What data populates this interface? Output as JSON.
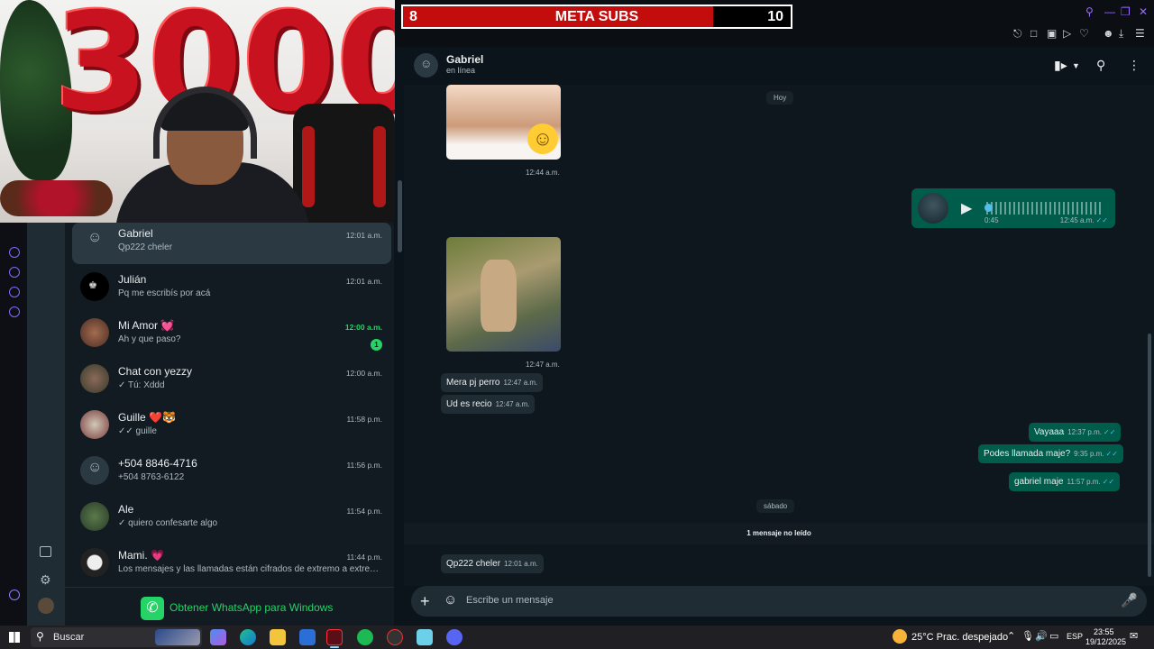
{
  "meta_bar": {
    "current": "8",
    "title": "META SUBS",
    "goal": "10",
    "progress": 0.8,
    "fill_color": "#c30d0d"
  },
  "webcam": {
    "balloon_text": "3000"
  },
  "chat_list": [
    {
      "name": "Gabriel",
      "preview": "Qp222 cheler",
      "time": "12:01 a.m.",
      "active": true,
      "avatar": "default-avatar"
    },
    {
      "name": "Julián",
      "preview": "Pq me escribís por acá",
      "time": "12:01 a.m.",
      "avatar": "crown-avatar"
    },
    {
      "name": "Mi Amor 💓",
      "preview": "Ah y que paso?",
      "time": "12:00 a.m.",
      "unread": "1",
      "avatar": "photo-avatar"
    },
    {
      "name": "Chat con yezzy",
      "preview": "✓ Tú: Xddd",
      "time": "12:00 a.m.",
      "avatar": "photo-avatar"
    },
    {
      "name": "Guille ❤️🐯",
      "preview": "✓✓ guille",
      "time": "11:58 p.m.",
      "avatar": "photo-avatar"
    },
    {
      "name": "+504 8846-4716",
      "preview": "+504 8763-6122",
      "time": "11:56 p.m.",
      "avatar": "default-avatar"
    },
    {
      "name": "Ale",
      "preview": "✓ quiero confesarte algo",
      "time": "11:54 p.m.",
      "avatar": "photo-avatar"
    },
    {
      "name": "Mami. 💗",
      "preview": "Los mensajes y las llamadas están cifrados de extremo a extremo. ...",
      "time": "11:44 p.m.",
      "avatar": "photo-avatar"
    }
  ],
  "get_whatsapp": "Obtener WhatsApp para Windows",
  "conversation": {
    "name": "Gabriel",
    "status": "en línea",
    "date_hoy": "Hoy",
    "img1_time": "12:44 a.m.",
    "voice": {
      "duration": "0:45",
      "time": "12:45 a.m.",
      "ticks": "✓✓"
    },
    "img2_time": "12:47 a.m.",
    "in_msgs": [
      {
        "text": "Mera pj perro",
        "time": "12:47 a.m."
      },
      {
        "text": "Ud es recio",
        "time": "12:47 a.m."
      }
    ],
    "out_msgs": [
      {
        "text": "Vayaaa",
        "time": "12:37 p.m.",
        "ticks": "✓✓"
      },
      {
        "text": "Podes llamada maje?",
        "time": "9:35 p.m.",
        "ticks": "✓✓"
      },
      {
        "text": "gabriel maje",
        "time": "11:57 p.m.",
        "ticks": "✓✓"
      }
    ],
    "date_sabado": "sábado",
    "unread_banner": "1 mensaje no leído",
    "last_msg": {
      "text": "Qp222 cheler",
      "time": "12:01 a.m."
    }
  },
  "composer": {
    "placeholder": "Escribe un mensaje"
  },
  "taskbar": {
    "search_text": "Buscar",
    "weather": "25°C  Prac. despejado",
    "lang": "ESP",
    "time": "23:55",
    "date": "19/12/2025"
  }
}
